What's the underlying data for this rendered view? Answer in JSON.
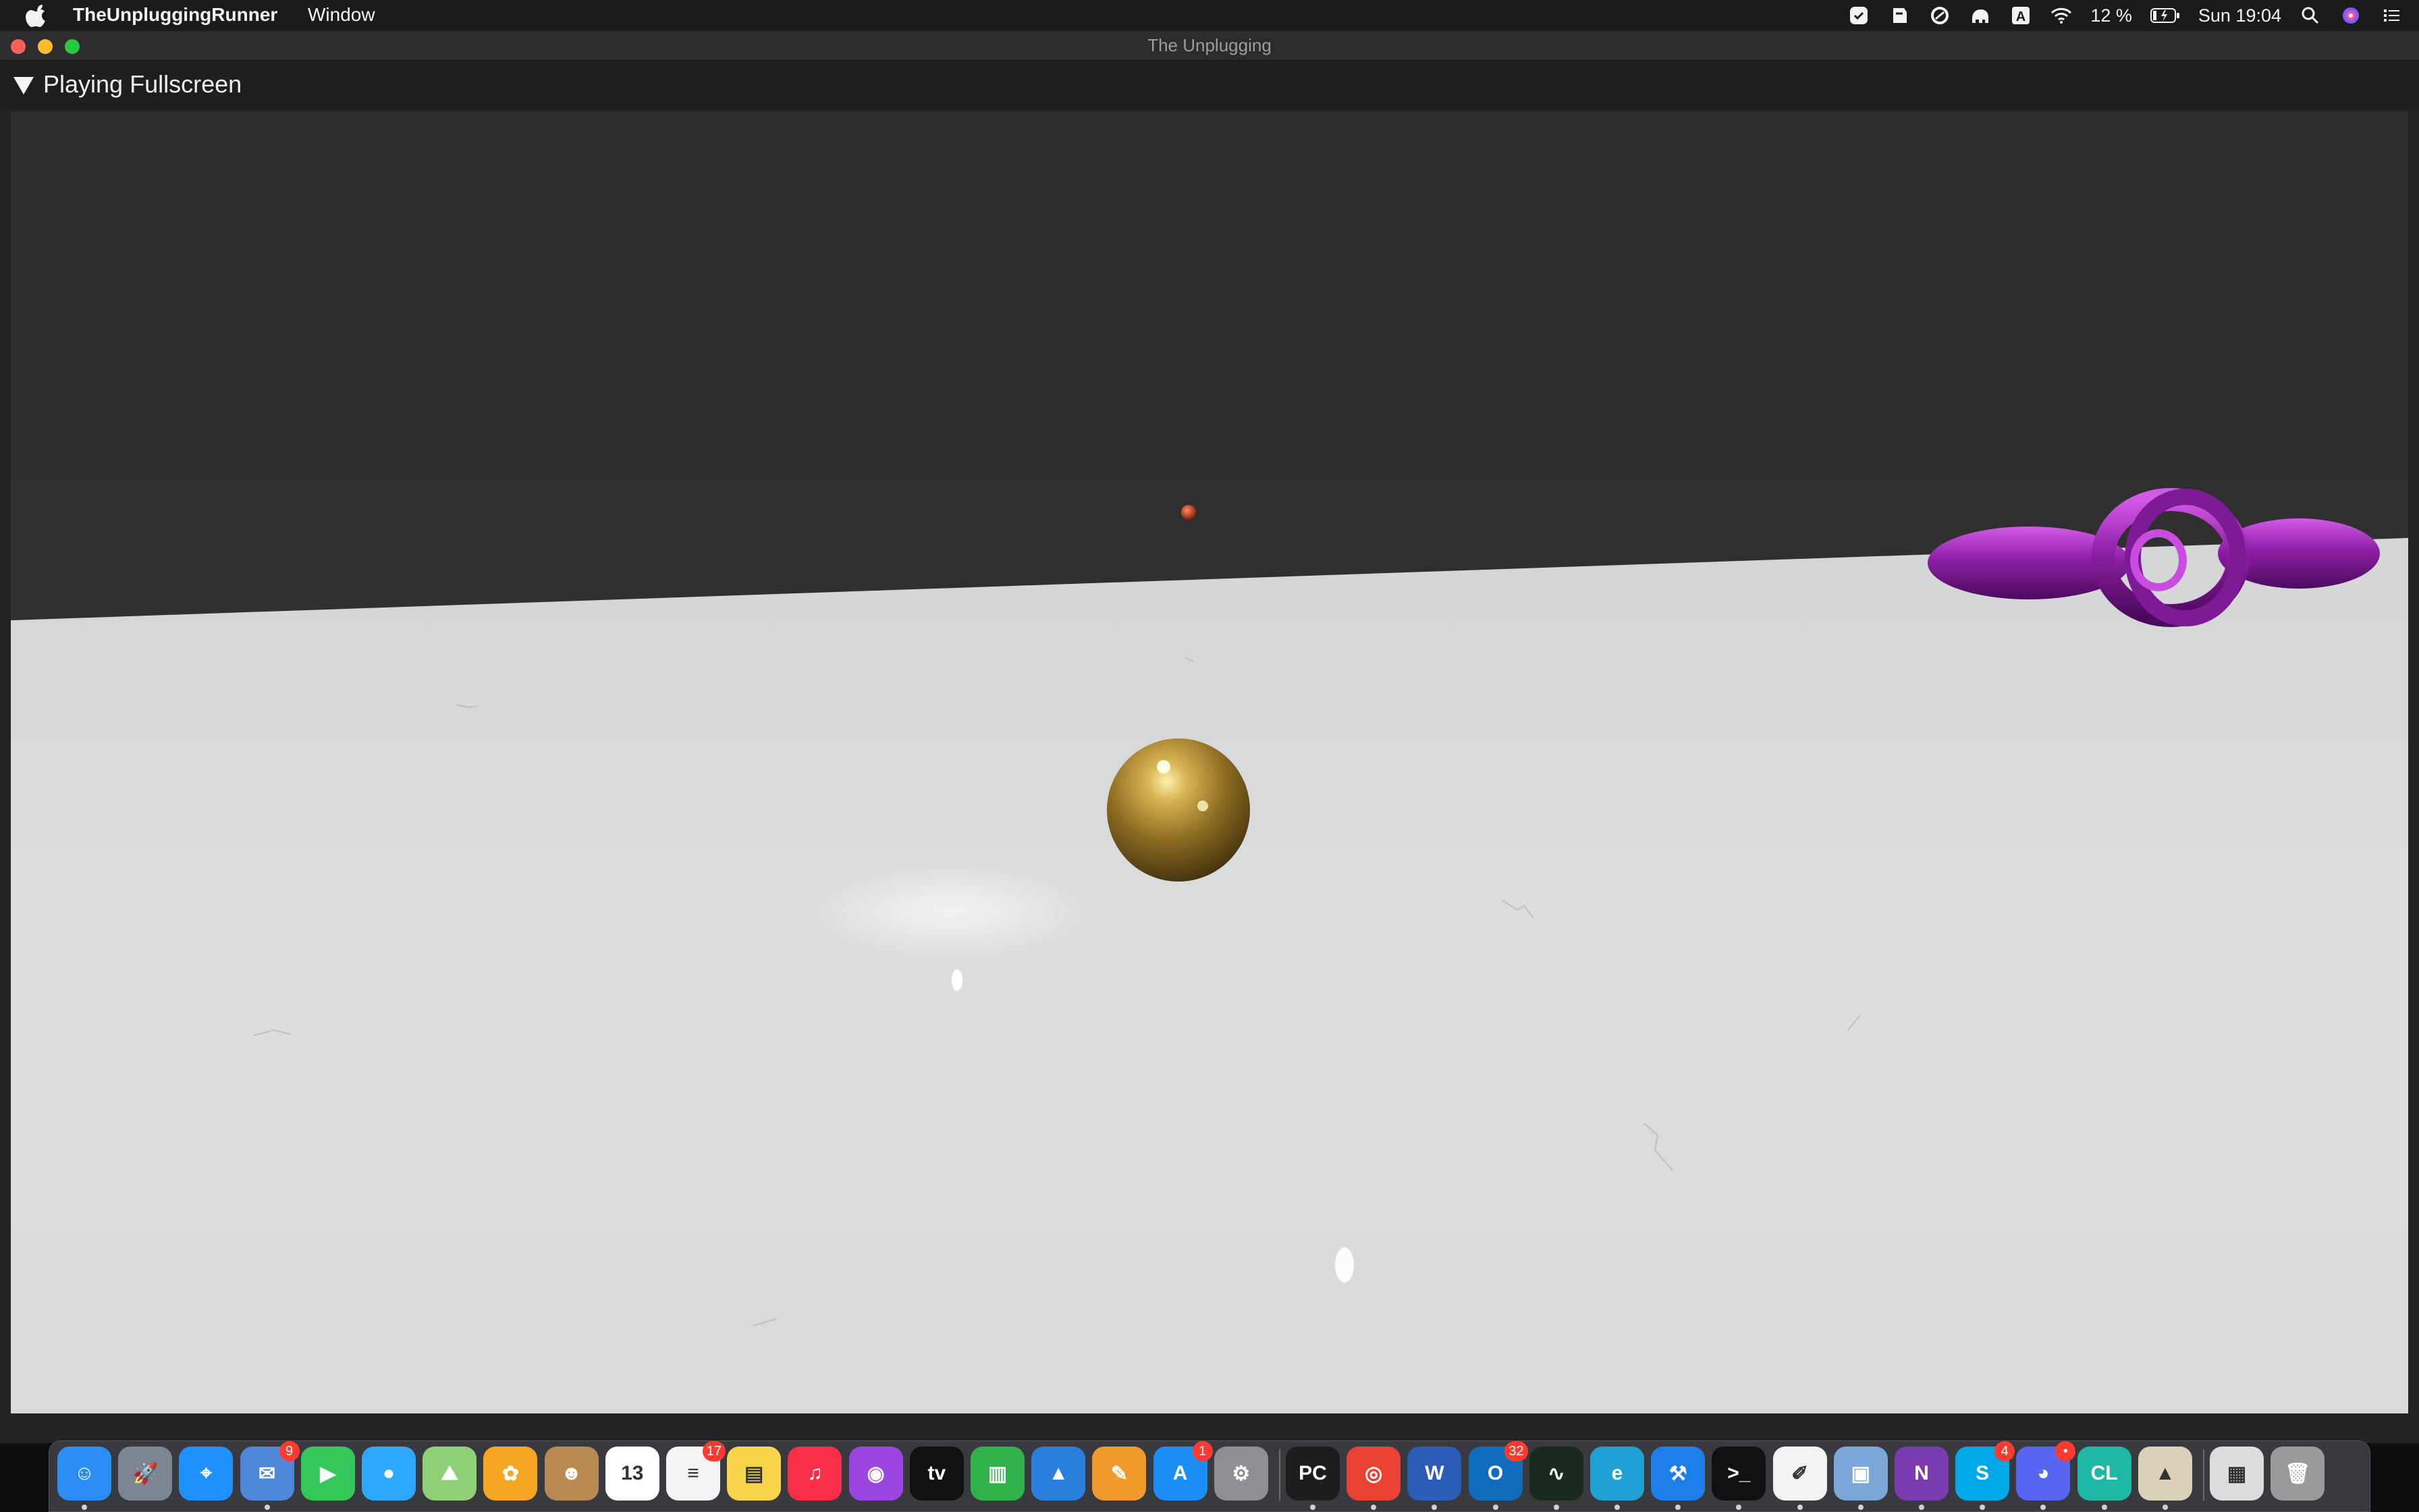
{
  "menubar": {
    "app_name": "TheUnpluggingRunner",
    "menus": [
      "Window"
    ],
    "battery": "12 %",
    "clock": "Sun 19:04",
    "status_icons": [
      "dropbox-icon",
      "script-icon",
      "sync-icon",
      "elephant-icon",
      "input-source-icon",
      "wifi-icon",
      "battery-icon",
      "spotlight-icon",
      "siri-icon",
      "control-center-icon"
    ]
  },
  "window": {
    "title": "The Unplugging",
    "toolbar_label": "Playing Fullscreen"
  },
  "dock": {
    "apps": [
      {
        "name": "finder",
        "glyph": "☺",
        "color": "#2a8df5",
        "dot": true
      },
      {
        "name": "launchpad",
        "glyph": "🚀",
        "color": "#7d8593",
        "dot": false
      },
      {
        "name": "safari",
        "glyph": "⌖",
        "color": "#1e90ff",
        "dot": false
      },
      {
        "name": "mail",
        "glyph": "✉",
        "color": "#4f87d9",
        "badge": "9",
        "dot": true
      },
      {
        "name": "facetime",
        "glyph": "▶",
        "color": "#34c759",
        "dot": false
      },
      {
        "name": "messages",
        "glyph": "●",
        "color": "#2ea8ff",
        "dot": false
      },
      {
        "name": "maps",
        "glyph": "⛰",
        "color": "#8fcf78",
        "dot": false
      },
      {
        "name": "photos",
        "glyph": "✿",
        "color": "#f5a623",
        "dot": false
      },
      {
        "name": "contacts",
        "glyph": "☻",
        "color": "#b88a52",
        "dot": false
      },
      {
        "name": "calendar",
        "glyph": "13",
        "color": "#ffffff",
        "dot": false
      },
      {
        "name": "reminders",
        "glyph": "≡",
        "color": "#f4f4f4",
        "badge": "17",
        "dot": false
      },
      {
        "name": "notes",
        "glyph": "▤",
        "color": "#f7d44a",
        "dot": false
      },
      {
        "name": "music",
        "glyph": "♫",
        "color": "#fa2d48",
        "dot": false
      },
      {
        "name": "podcasts",
        "glyph": "◉",
        "color": "#9b46e3",
        "dot": false
      },
      {
        "name": "apple-tv",
        "glyph": "tv",
        "color": "#111111",
        "dot": false
      },
      {
        "name": "numbers",
        "glyph": "▥",
        "color": "#2fb24a",
        "dot": false
      },
      {
        "name": "keynote",
        "glyph": "▲",
        "color": "#2a7fdd",
        "dot": false
      },
      {
        "name": "pages",
        "glyph": "✎",
        "color": "#f19a2c",
        "dot": false
      },
      {
        "name": "app-store",
        "glyph": "A",
        "color": "#1b8ef8",
        "badge": "1",
        "dot": false
      },
      {
        "name": "system-preferences",
        "glyph": "⚙",
        "color": "#8e8e93",
        "dot": false
      },
      {
        "name": "pycharm",
        "glyph": "PC",
        "color": "#1d1d1d",
        "dot": true
      },
      {
        "name": "chrome",
        "glyph": "◎",
        "color": "#e94235",
        "dot": true
      },
      {
        "name": "word",
        "glyph": "W",
        "color": "#2b5cb8",
        "dot": true
      },
      {
        "name": "outlook",
        "glyph": "O",
        "color": "#0f6cbd",
        "badge": "32",
        "dot": true
      },
      {
        "name": "activity-monitor",
        "glyph": "∿",
        "color": "#1a2a1e",
        "dot": true
      },
      {
        "name": "edge",
        "glyph": "e",
        "color": "#1fa1d4",
        "dot": true
      },
      {
        "name": "xcode",
        "glyph": "⚒",
        "color": "#1c7ee8",
        "dot": true
      },
      {
        "name": "terminal",
        "glyph": ">_",
        "color": "#111111",
        "dot": true
      },
      {
        "name": "textedit",
        "glyph": "✐",
        "color": "#f2f2f2",
        "dot": true
      },
      {
        "name": "preview",
        "glyph": "▣",
        "color": "#7aa6d8",
        "dot": true
      },
      {
        "name": "onenote",
        "glyph": "N",
        "color": "#7a3bb0",
        "dot": true
      },
      {
        "name": "skype",
        "glyph": "S",
        "color": "#00a8e8",
        "badge": "4",
        "dot": true
      },
      {
        "name": "discord",
        "glyph": "◕",
        "color": "#5865f2",
        "badge": "•",
        "dot": true
      },
      {
        "name": "clion",
        "glyph": "CL",
        "color": "#1fb8a5",
        "dot": true
      },
      {
        "name": "instruments",
        "glyph": "▲",
        "color": "#d9d2b8",
        "dot": true
      },
      {
        "name": "documents-stack",
        "glyph": "▦",
        "color": "#dcdcdc",
        "dot": false
      },
      {
        "name": "trash",
        "glyph": "🗑",
        "color": "#9a9a9a",
        "dot": false
      }
    ]
  },
  "colors": {
    "floor": "#d8d9da",
    "sky": "#2f2f2f",
    "gold": "#b08a30",
    "torus": "#9a22b0",
    "sphere_small": "#b03a1a"
  }
}
